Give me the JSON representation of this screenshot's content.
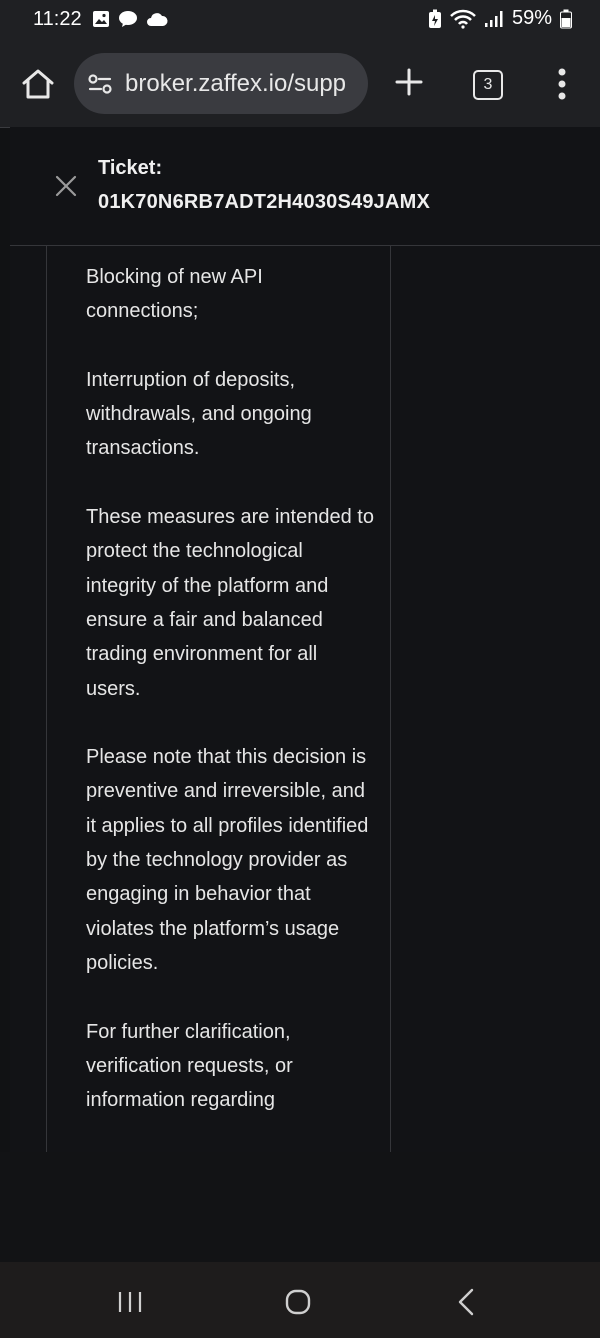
{
  "status_bar": {
    "time": "11:22",
    "battery": "59%",
    "left_icons": [
      "gallery-icon",
      "chat-icon",
      "cloud-icon"
    ],
    "right_icons": [
      "battery-saver-icon",
      "wifi-icon",
      "signal-icon",
      "battery-icon"
    ]
  },
  "browser": {
    "url": "broker.zaffex.io/supp",
    "tab_count": "3"
  },
  "ticket": {
    "label": "Ticket:",
    "id": "01K70N6RB7ADT2H4030S49JAMX"
  },
  "message": {
    "paragraphs": [
      "Blocking of new API connections;",
      "Interruption of deposits, withdrawals, and ongoing transactions.",
      "These measures are intended to protect the technological integrity of the platform and ensure a fair and balanced trading environment for all users.",
      "Please note that this decision is preventive and irreversible, and it applies to all profiles identified by the technology provider as engaging in behavior that violates the platform’s usage policies.",
      "For further clarification, verification requests, or information regarding"
    ]
  },
  "colors": {
    "background": "#111214",
    "toolbar": "#1f2023",
    "url_pill": "#3a3b40",
    "text": "#e6e6e6"
  }
}
